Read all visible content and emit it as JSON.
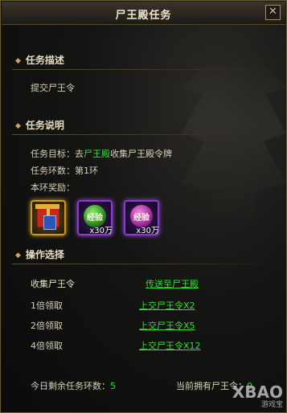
{
  "window": {
    "title": "尸王殿任务",
    "close_symbol": "✕"
  },
  "description": {
    "heading": "任务描述",
    "text": "提交尸王令"
  },
  "explanation": {
    "heading": "任务说明",
    "goal_prefix": "任务目标：去",
    "goal_place": "尸王殿",
    "goal_suffix": "收集尸王殿令牌",
    "rounds": "任务环数：第1环",
    "reward_label": "本环奖励："
  },
  "rewards": [
    {
      "name": "gift-box",
      "quantity": ""
    },
    {
      "name": "经验",
      "quantity": "x30万"
    },
    {
      "name": "经验",
      "quantity": "x30万"
    }
  ],
  "operations": {
    "heading": "操作选择",
    "rows": [
      {
        "label": "收集尸王令",
        "action": "传送至尸王殿"
      },
      {
        "label": "1倍领取",
        "action": "上交尸王令X2"
      },
      {
        "label": "2倍领取",
        "action": "上交尸王令X5"
      },
      {
        "label": "4倍领取",
        "action": "上交尸王令X12"
      }
    ]
  },
  "footer": {
    "remaining_label": "今日剩余任务环数：",
    "remaining_value": "5",
    "owned_label": "当前拥有尸王令：",
    "owned_value": "0"
  },
  "watermark": {
    "logo": "XBAO",
    "sub": "游戏宝"
  },
  "colors": {
    "highlight": "#33dd33",
    "text": "#d8d0b8",
    "border": "#6b5a38"
  }
}
